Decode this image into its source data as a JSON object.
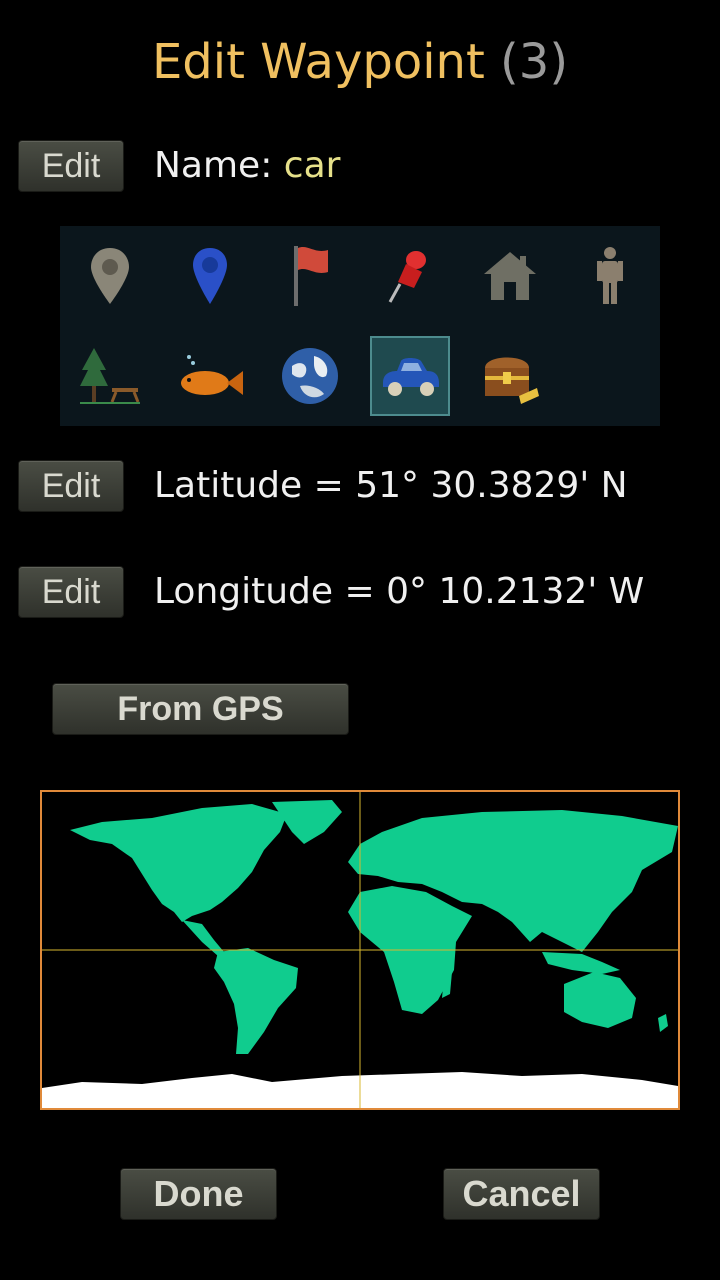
{
  "header": {
    "title": "Edit Waypoint",
    "count": "(3)"
  },
  "name_row": {
    "edit_label": "Edit",
    "label": "Name:",
    "value": "car"
  },
  "icons": {
    "items": [
      {
        "name": "gray-map-pin-icon"
      },
      {
        "name": "blue-map-pin-icon"
      },
      {
        "name": "red-flag-icon"
      },
      {
        "name": "red-push-pin-icon"
      },
      {
        "name": "house-icon"
      },
      {
        "name": "person-icon"
      },
      {
        "name": "picnic-tree-icon"
      },
      {
        "name": "fish-icon"
      },
      {
        "name": "earth-globe-icon"
      },
      {
        "name": "car-icon",
        "selected": true
      },
      {
        "name": "treasure-chest-icon"
      }
    ]
  },
  "latitude_row": {
    "edit_label": "Edit",
    "text": "Latitude = 51° 30.3829' N"
  },
  "longitude_row": {
    "edit_label": "Edit",
    "text": "Longitude = 0° 10.2132' W"
  },
  "gps_button": {
    "label": "From GPS"
  },
  "footer": {
    "done_label": "Done",
    "cancel_label": "Cancel"
  },
  "colors": {
    "title": "#f0c060",
    "name_value": "#e6e08a",
    "land": "#10cc8e",
    "map_border": "#e08a3a",
    "crosshair": "#d8b830"
  }
}
